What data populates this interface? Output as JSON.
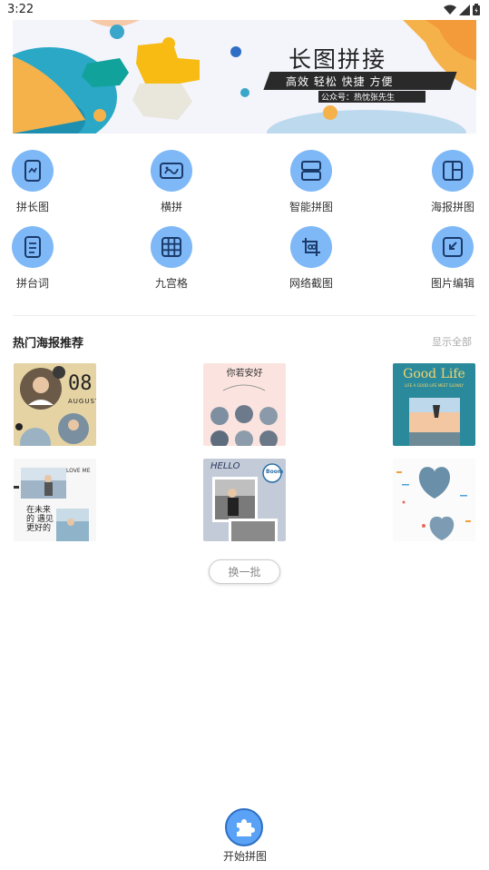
{
  "status_bar": {
    "time": "3:22"
  },
  "banner": {
    "title": "长图拼接",
    "subtitle": "高效 轻松 快捷 方便",
    "tag": "公众号：热忱张先生"
  },
  "tools": [
    {
      "label": "拼长图",
      "icon": "long-image-icon"
    },
    {
      "label": "横拼",
      "icon": "horizontal-stitch-icon"
    },
    {
      "label": "智能拼图",
      "icon": "smart-collage-icon"
    },
    {
      "label": "海报拼图",
      "icon": "poster-collage-icon"
    },
    {
      "label": "拼台词",
      "icon": "subtitle-stitch-icon"
    },
    {
      "label": "九宫格",
      "icon": "nine-grid-icon"
    },
    {
      "label": "网络截图",
      "icon": "web-screenshot-icon"
    },
    {
      "label": "图片编辑",
      "icon": "image-edit-icon"
    }
  ],
  "hot_posters": {
    "title": "热门海报推荐",
    "show_all": "显示全部",
    "cards": [
      {
        "text": "08",
        "subtext": "AUGUST"
      },
      {
        "text": "你若安好"
      },
      {
        "text": "Good Life",
        "subtext": "LIFE A GOOD LIFE MEET SLOWLY"
      },
      {
        "text": "LOVE ME",
        "subtext": "在未来的 遇见更好的"
      },
      {
        "text": "HELLO",
        "subtext": "Boom"
      },
      {
        "text": ""
      }
    ],
    "refresh_label": "换一批"
  },
  "bottom": {
    "start_label": "开始拼图"
  },
  "colors": {
    "accent": "#7eb8f7",
    "primary": "#5aa2f5"
  }
}
